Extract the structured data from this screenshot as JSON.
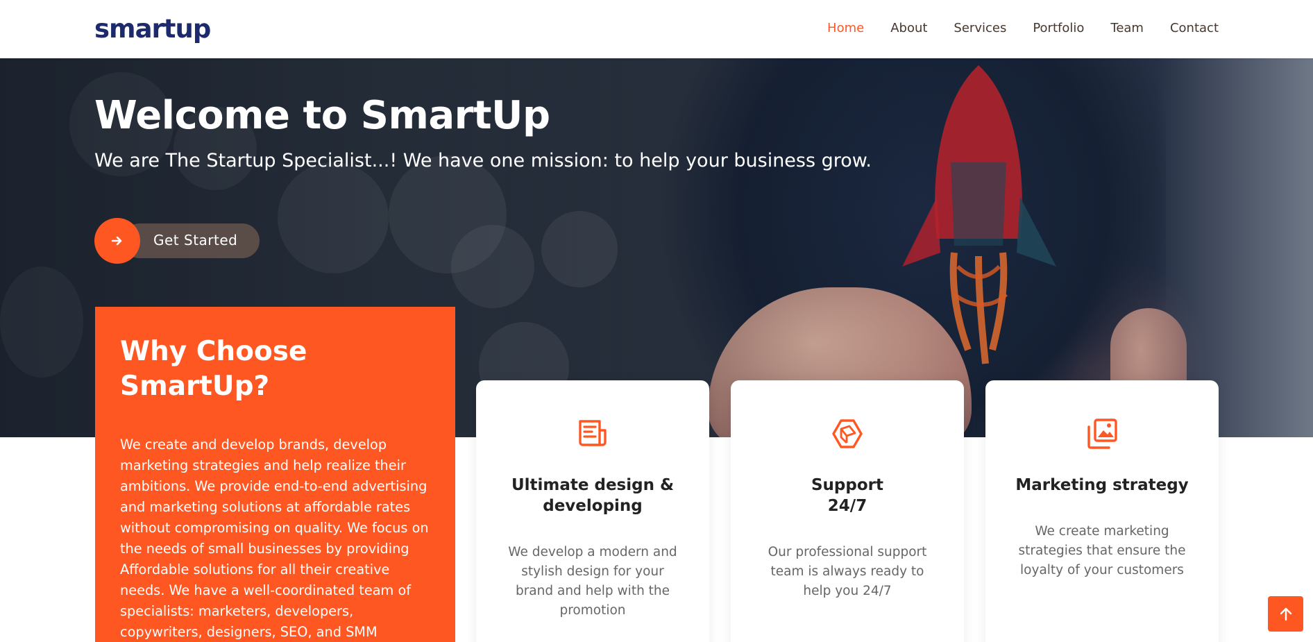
{
  "brand": {
    "logo_text": "smartup",
    "accent": "#ff5722",
    "navy": "#1d2b6c"
  },
  "nav": {
    "items": [
      {
        "label": "Home",
        "active": true
      },
      {
        "label": "About",
        "active": false
      },
      {
        "label": "Services",
        "active": false
      },
      {
        "label": "Portfolio",
        "active": false
      },
      {
        "label": "Team",
        "active": false
      },
      {
        "label": "Contact",
        "active": false
      }
    ]
  },
  "hero": {
    "title": "Welcome to SmartUp",
    "subtitle": "We are The Startup Specialist...! We have one mission: to help your business grow.",
    "cta_label": "Get Started",
    "cta_icon": "arrow-right-icon"
  },
  "why": {
    "title": "Why Choose SmartUp?",
    "text": "We create and develop brands, develop marketing strategies and help realize their ambitions. We provide end-to-end advertising and marketing solutions at affordable rates without compromising on quality. We focus on the needs of small businesses by providing Affordable solutions for all their creative needs. We have a well-coordinated team of specialists: marketers, developers, copywriters, designers, SEO, and SMM specialists."
  },
  "features": [
    {
      "icon": "newspaper-icon",
      "title": "Ultimate design & developing",
      "text": "We develop a modern and stylish design for your brand and help with the promotion"
    },
    {
      "icon": "box-icon",
      "title": "Support 24/7",
      "text": "Our professional support team is always ready to help you 24/7"
    },
    {
      "icon": "images-icon",
      "title": "Marketing strategy",
      "text": "We create marketing strategies that ensure the loyalty of your customers"
    }
  ],
  "back_to_top": {
    "icon": "arrow-up-icon"
  }
}
